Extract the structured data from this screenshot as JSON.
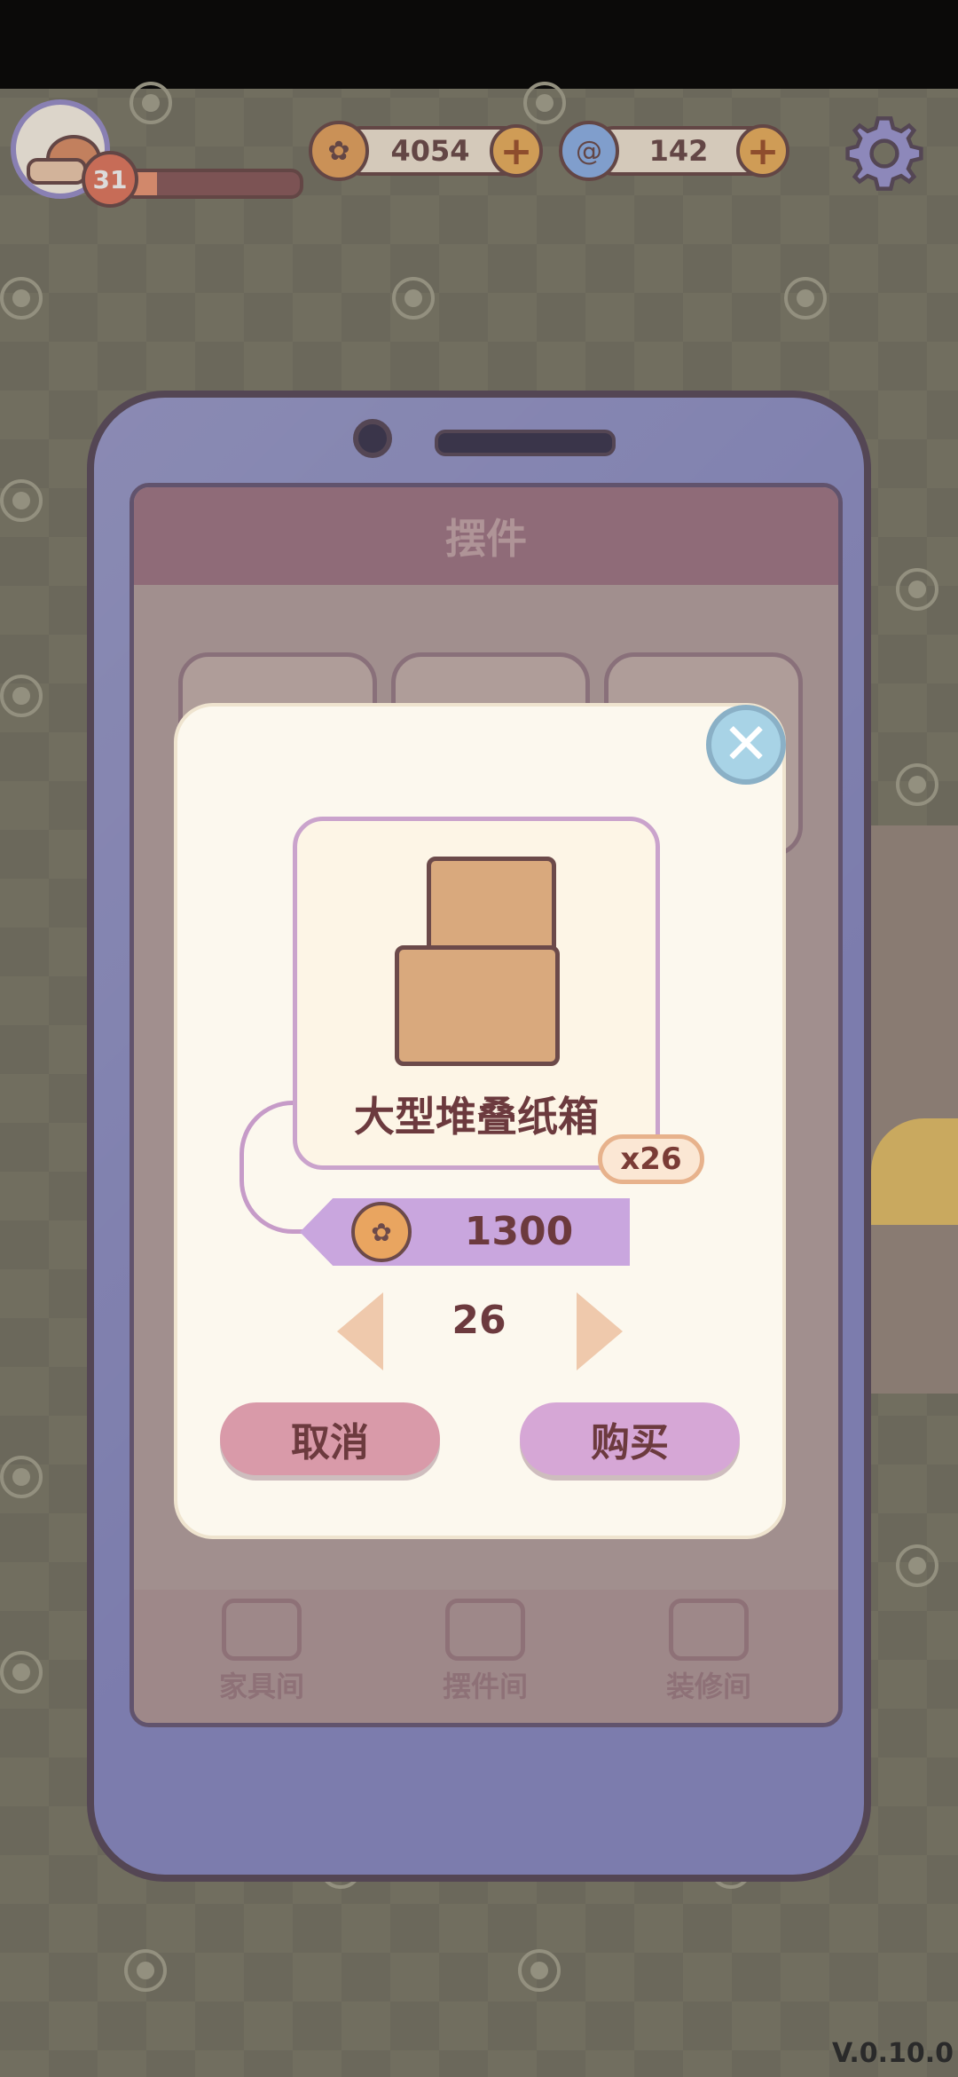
{
  "hud": {
    "level": "31",
    "xp_progress": 0.18,
    "coins": "4054",
    "gems": "142"
  },
  "phone": {
    "header_title": "摆件",
    "nav": [
      {
        "label": "家具间"
      },
      {
        "label": "摆件间"
      },
      {
        "label": "装修间"
      }
    ]
  },
  "modal": {
    "item_name": "大型堆叠纸箱",
    "stock_badge": "x26",
    "price": "1300",
    "quantity": "26",
    "cancel_label": "取消",
    "buy_label": "购买",
    "close_symbol": "✕"
  },
  "footer": {
    "version": "V.0.10.0"
  },
  "colors": {
    "modal_bg": "#fcf8ee",
    "price_tag": "#c9a6de",
    "cancel_button": "#d99aa9",
    "buy_button": "#d6a7d6",
    "phone_frame": "#8a8cc8",
    "text_dark": "#6c3a3e"
  },
  "icons": {
    "coin": "coin-icon",
    "gem": "spiral-gem-icon",
    "settings": "gear-icon",
    "close": "close-icon",
    "box": "cardboard-box-icon"
  }
}
